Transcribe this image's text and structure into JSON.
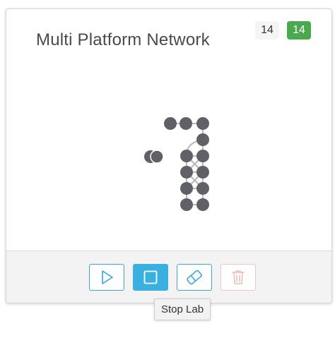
{
  "lab": {
    "title": "Multi Platform Network",
    "badge_total": "14",
    "badge_running": "14"
  },
  "toolbar": {
    "start_icon": "play-icon",
    "stop_icon": "stop-icon",
    "wipe_icon": "eraser-icon",
    "delete_icon": "trash-icon"
  },
  "tooltip": {
    "text": "Stop Lab"
  },
  "colors": {
    "node": "#5f6166",
    "link": "#b9b9b9",
    "accent": "#39b0e0",
    "success": "#4aa84f",
    "danger_light": "#f3c4c4"
  }
}
